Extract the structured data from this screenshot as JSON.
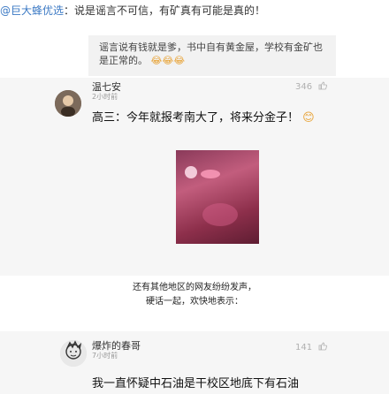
{
  "post": {
    "mention": "@巨大蜂优选",
    "text": "：说是谣言不可信，有矿真有可能是真的！"
  },
  "quote": {
    "text": "谣言说有钱就是爹，书中自有黄金屋，学校有金矿也是正常的。",
    "emoji": "😂😂😂"
  },
  "comments": [
    {
      "username": "温七安",
      "time": "2小时前",
      "likes": "346",
      "text": "高三：今年就报考南大了，将来分金子！",
      "emoji": "😊"
    },
    {
      "username": "爆炸的春哥",
      "time": "7小时前",
      "likes": "141",
      "text": "我一直怀疑中石油是干校区地底下有石油"
    }
  ],
  "caption": {
    "line1": "还有其他地区的网友纷纷发声，",
    "line2": "硬话一起，欢快地表示："
  },
  "icons": {
    "like": "thumbs-up-icon",
    "avatar1": "user-avatar",
    "avatar2": "user-avatar-cartoon"
  }
}
